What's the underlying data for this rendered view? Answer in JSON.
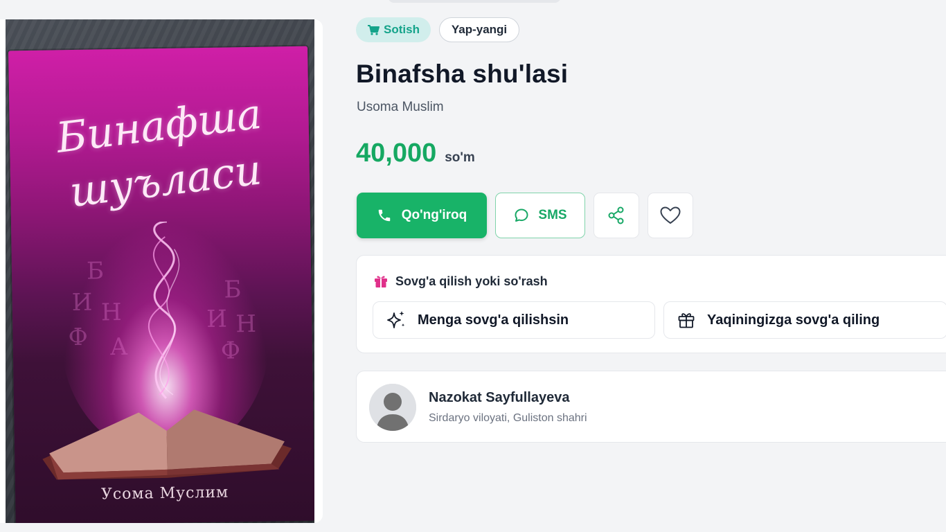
{
  "listing": {
    "badges": {
      "type": "Sotish",
      "condition": "Yap-yangi"
    },
    "title": "Binafsha shu'lasi",
    "author": "Usoma Muslim",
    "price": {
      "value": "40,000",
      "currency": "so'm"
    },
    "image": {
      "cover_title_line1": "Бинафша",
      "cover_title_line2": "шуъласи",
      "cover_author": "Усома Муслим"
    }
  },
  "actions": {
    "call_label": "Qo'ng'iroq",
    "sms_label": "SMS"
  },
  "gift": {
    "heading": "Sovg'a qilish yoki so'rash",
    "option_request": "Menga sovg'a qilishsin",
    "option_give": "Yaqiningizga sovg'a qiling"
  },
  "seller": {
    "name": "Nazokat Sayfullayeva",
    "location": "Sirdaryo viloyati, Guliston shahri"
  },
  "colors": {
    "accent_green": "#18b368",
    "sell_badge_bg": "#d1eeec",
    "sell_badge_text": "#14a38a",
    "gift_pink": "#e0308a"
  },
  "icons": [
    "cart-icon",
    "phone-icon",
    "chat-icon",
    "share-icon",
    "heart-icon",
    "gift-icon",
    "sparkles-icon",
    "avatar-placeholder-icon"
  ]
}
